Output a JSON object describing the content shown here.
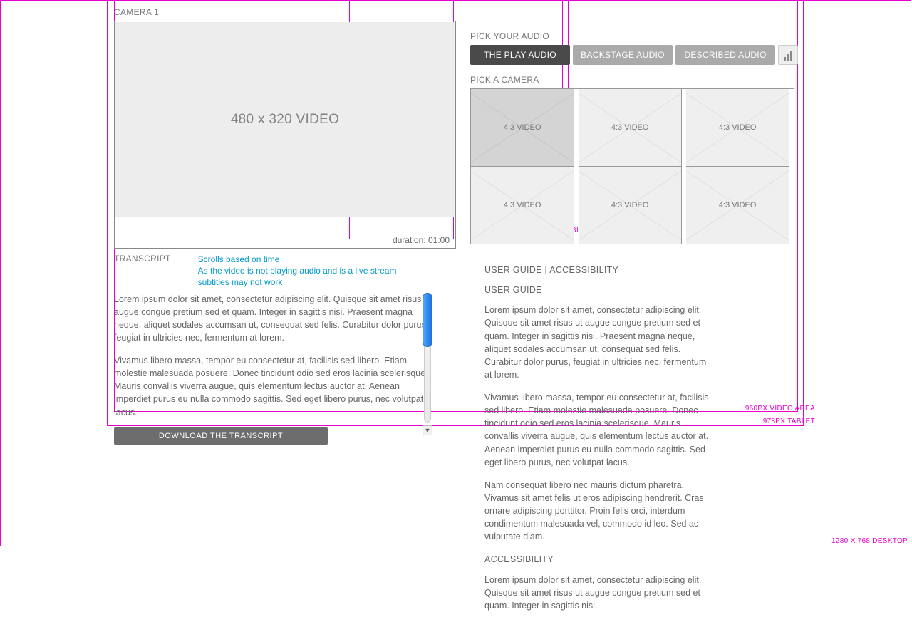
{
  "left": {
    "camera_label": "CAMERA 1",
    "video_placeholder": "480 x 320 VIDEO",
    "duration": "duration: 01:00"
  },
  "audio": {
    "heading": "PICK YOUR AUDIO",
    "options": [
      "THE PLAY AUDIO",
      "BACKSTAGE AUDIO",
      "DESCRIBED AUDIO"
    ]
  },
  "cameras": {
    "heading": "PICK A  CAMERA",
    "cell_label": "4:3 VIDEO"
  },
  "transcript": {
    "heading": "TRANSCRIPT",
    "note_line1": "Scrolls based on time",
    "note_line2": "As the video is not playing audio and is a live stream subtitles may not work",
    "para1": "Lorem ipsum dolor sit amet, consectetur adipiscing elit. Quisque sit amet risus ut augue congue pretium sed et quam. Integer in sagittis nisi. Praesent magna neque, aliquet sodales accumsan ut, consequat sed felis. Curabitur dolor purus, feugiat in ultricies nec, fermentum at lorem.",
    "para2": " Vivamus libero massa, tempor eu consectetur at, facilisis sed libero. Etiam molestie malesuada posuere. Donec tincidunt odio sed eros lacinia scelerisque. Mauris convallis viverra augue, quis elementum lectus auctor at. Aenean imperdiet purus eu nulla commodo sagittis. Sed eget libero purus, nec volutpat lacus.",
    "download": "DOWNLOAD THE TRANSCRIPT"
  },
  "guide": {
    "heading": "USER GUIDE  |  ACCESSIBILITY",
    "sub1": "USER GUIDE",
    "p1": "Lorem ipsum dolor sit amet, consectetur adipiscing elit. Quisque sit amet risus ut augue congue pretium sed et quam. Integer in sagittis nisi. Praesent magna neque, aliquet sodales accumsan ut, consequat sed felis. Curabitur dolor purus, feugiat in ultricies nec, fermentum at lorem.",
    "p2": " Vivamus libero massa, tempor eu consectetur at, facilisis sed libero. Etiam molestie malesuada posuere. Donec tincidunt odio sed eros lacinia scelerisque. Mauris convallis viverra augue, quis elementum lectus auctor at. Aenean imperdiet purus eu nulla commodo sagittis. Sed eget libero purus, nec volutpat lacus.",
    "p3": "Nam consequat libero nec mauris dictum pharetra. Vivamus sit amet felis ut eros adipiscing hendrerit. Cras ornare adipiscing porttitor. Proin felis orci, interdum condimentum malesuada vel, commodo id leo. Sed ac vulputate diam.",
    "sub2": "ACCESSIBILITY",
    "p4": "Lorem ipsum dolor sit amet, consectetur adipiscing elit. Quisque sit amet risus ut augue congue pretium sed et quam. Integer in sagittis nisi."
  },
  "frames": {
    "desktop": "1280 X 768 DESKTOP",
    "tablet": "978PX  TABLET",
    "video": "960PX  VIDEO AREA",
    "mobile": "300PX  SPACES MOBILE"
  }
}
